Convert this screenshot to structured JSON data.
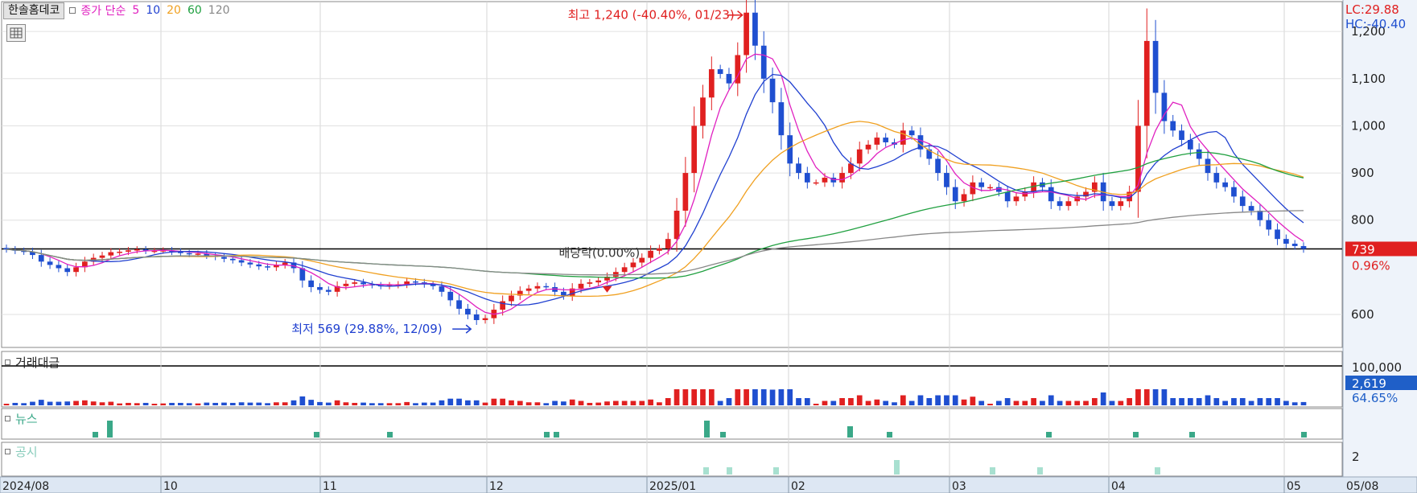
{
  "header": {
    "stock_name": "한솔홈데코",
    "price_type": "종가 단순",
    "ma_periods": [
      "5",
      "10",
      "20",
      "60",
      "120"
    ],
    "ma_colors": [
      "#e020c0",
      "#2040d0",
      "#f0a020",
      "#20a040",
      "#888888"
    ]
  },
  "right_labels": {
    "lc": "LC:29.88",
    "hc": "HC:-40.40",
    "current_price": "739",
    "change_pct": "0.96%",
    "volume_max": "100,000",
    "volume_current": "2,619",
    "volume_pct": "64.65%",
    "disclosure_scale": "2"
  },
  "annotations": {
    "high": "최고 1,240 (-40.40%, 01/23)",
    "low": "최저 569 (29.88%, 12/09)",
    "dividend": "배당락(0.00%)"
  },
  "panels": {
    "volume_label": "거래대금",
    "news_label": "뉴스",
    "disclosure_label": "공시"
  },
  "chart_data": {
    "type": "candlestick",
    "price_axis_ticks": [
      "1,200",
      "1,100",
      "1,000",
      "900",
      "800",
      "600"
    ],
    "price_axis_tick_values": [
      1200,
      1100,
      1000,
      900,
      800,
      600
    ],
    "ylim": [
      530,
      1260
    ],
    "x_tick_labels": [
      "2024/08",
      "10",
      "11",
      "12",
      "2025/01",
      "02",
      "03",
      "04",
      "05",
      "05/08"
    ],
    "reference_line": 739,
    "high_point": {
      "date": "01/23",
      "price": 1240
    },
    "low_point": {
      "date": "12/09",
      "price": 569
    },
    "candles_close": [
      738,
      735,
      733,
      726,
      712,
      705,
      698,
      690,
      700,
      712,
      720,
      725,
      732,
      733,
      736,
      738,
      735,
      735,
      736,
      733,
      730,
      728,
      729,
      725,
      722,
      718,
      715,
      710,
      706,
      702,
      700,
      705,
      710,
      698,
      672,
      658,
      652,
      648,
      660,
      665,
      668,
      664,
      662,
      660,
      662,
      664,
      670,
      668,
      664,
      660,
      648,
      630,
      612,
      600,
      588,
      592,
      610,
      628,
      640,
      650,
      655,
      660,
      658,
      648,
      640,
      655,
      665,
      668,
      672,
      680,
      690,
      700,
      710,
      720,
      735,
      740,
      760,
      820,
      900,
      1000,
      1060,
      1120,
      1110,
      1090,
      1150,
      1240,
      1170,
      1100,
      1050,
      980,
      920,
      900,
      880,
      880,
      890,
      880,
      900,
      920,
      950,
      960,
      975,
      965,
      960,
      990,
      980,
      950,
      930,
      900,
      870,
      840,
      855,
      880,
      870,
      870,
      860,
      840,
      850,
      860,
      880,
      870,
      840,
      830,
      840,
      850,
      860,
      880,
      840,
      830,
      840,
      860,
      1000,
      1180,
      1070,
      1010,
      990,
      970,
      950,
      930,
      900,
      880,
      870,
      850,
      830,
      820,
      800,
      780,
      760,
      750,
      745,
      739
    ],
    "volume_series_note": "거래대금",
    "news_bars": [
      {
        "date": "2024/09",
        "value": 1
      },
      {
        "date": "2024/09",
        "value": 3
      },
      {
        "date": "2024/11",
        "value": 1
      },
      {
        "date": "2024/11",
        "value": 1
      },
      {
        "date": "2024/12",
        "value": 1
      },
      {
        "date": "2024/12",
        "value": 1
      },
      {
        "date": "2025/01",
        "value": 3
      },
      {
        "date": "2025/01",
        "value": 1
      },
      {
        "date": "2025/02",
        "value": 2
      },
      {
        "date": "2025/02",
        "value": 1
      },
      {
        "date": "2025/03",
        "value": 1
      },
      {
        "date": "2025/04",
        "value": 1
      },
      {
        "date": "2025/04",
        "value": 1
      },
      {
        "date": "2025/05",
        "value": 1
      }
    ],
    "disclosure_bars": [
      {
        "date": "2025/01",
        "value": 1
      },
      {
        "date": "2025/01",
        "value": 1
      },
      {
        "date": "2025/01",
        "value": 1
      },
      {
        "date": "2025/02",
        "value": 2
      },
      {
        "date": "2025/03",
        "value": 1
      },
      {
        "date": "2025/03",
        "value": 1
      },
      {
        "date": "2025/04",
        "value": 1
      }
    ]
  }
}
